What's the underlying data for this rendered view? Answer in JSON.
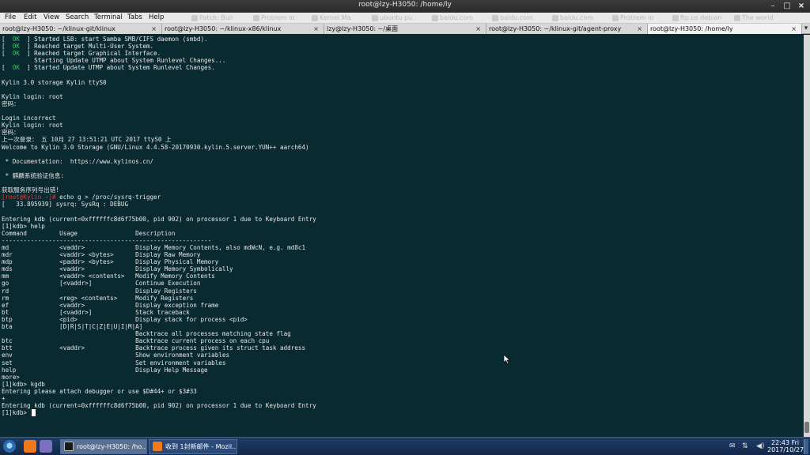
{
  "window": {
    "title": "root@lzy-H3050: /home/ly"
  },
  "menu": {
    "items": [
      "File",
      "Edit",
      "View",
      "Search",
      "Terminal",
      "Tabs",
      "Help"
    ],
    "ghost_tabs": [
      "Patch: Buil",
      "Problem lo",
      "Kernel Ma",
      "ubuntu pu",
      "baidu.com",
      "baidu.com",
      "baidu.com",
      "Problem lo",
      "ftp.us.debian",
      "The world"
    ]
  },
  "tabs": [
    {
      "label": "root@lzy-H3050: ~/klinux-git/klinux",
      "close": "×"
    },
    {
      "label": "root@lzy-H3050: ~/klinux-x86/klinux",
      "close": "×"
    },
    {
      "label": "lzy@lzy-H3050: ~/桌面",
      "close": "×"
    },
    {
      "label": "root@lzy-H3050: ~/klinux-git/agent-proxy",
      "close": "×"
    },
    {
      "label": "root@lzy-H3050: /home/ly",
      "close": "×"
    }
  ],
  "terminal": {
    "lines": [
      "[  OK  ] Started LSB: start Samba SMB/CIFS daemon (smbd).",
      "[  OK  ] Reached target Multi-User System.",
      "[  OK  ] Reached target Graphical Interface.",
      "         Starting Update UTMP about System Runlevel Changes...",
      "[  OK  ] Started Update UTMP about System Runlevel Changes.",
      "",
      "Kylin 3.0 storage Kylin ttyS0",
      "",
      "Kylin login: root",
      "密码：",
      "",
      "Login incorrect",
      "Kylin login: root",
      "密码：",
      "上一次登录： 五 10月 27 13:51:21 UTC 2017 ttyS0 上",
      "Welcome to Kylin 3.0 Storage (GNU/Linux 4.4.58-20170930.kylin.5.server.YUN++ aarch64)",
      "",
      " * Documentation:  https://www.kylinos.cn/",
      "",
      " * 麒麟系统验证信息:",
      "",
      "获取服务序列号出错!",
      "[root@Kylin ~]# echo g > /proc/sysrq-trigger",
      "[   33.895939] sysrq: SysRq : DEBUG",
      "",
      "Entering kdb (current=0xffffffc8d6f75b00, pid 902) on processor 1 due to Keyboard Entry",
      "[1]kdb> help",
      "Command         Usage                Description",
      "----------------------------------------------------------",
      "md              <vaddr>              Display Memory Contents, also mdWcN, e.g. md8c1",
      "mdr             <vaddr> <bytes>      Display Raw Memory",
      "mdp             <paddr> <bytes>      Display Physical Memory",
      "mds             <vaddr>              Display Memory Symbolically",
      "mm              <vaddr> <contents>   Modify Memory Contents",
      "go              [<vaddr>]            Continue Execution",
      "rd                                   Display Registers",
      "rm              <reg> <contents>     Modify Registers",
      "ef              <vaddr>              Display exception frame",
      "bt              [<vaddr>]            Stack traceback",
      "btp             <pid>                Display stack for process <pid>",
      "bta             [D|R|S|T|C|Z|E|U|I|M|A]",
      "                                     Backtrace all processes matching state flag",
      "btc                                  Backtrace current process on each cpu",
      "btt             <vaddr>              Backtrace process given its struct task address",
      "env                                  Show environment variables",
      "set                                  Set environment variables",
      "help                                 Display Help Message",
      "more>",
      "[1]kdb> kgdb",
      "Entering please attach debugger or use $D#44+ or $3#33",
      "+",
      "Entering kdb (current=0xffffffc8d6f75b00, pid 902) on processor 1 due to Keyboard Entry",
      "[1]kdb> "
    ]
  },
  "taskbar": {
    "tasks": [
      {
        "label": "root@lzy-H3050: /ho..."
      },
      {
        "label": "收到 1封新邮件 - Mozil..."
      }
    ],
    "clock": {
      "time": "22:43 Fri",
      "date": "2017/10/27"
    }
  },
  "colors": {
    "terminal_bg": "#0a2a32",
    "terminal_fg": "#e6e6e6",
    "ok_green": "#2fcf4f",
    "prompt_red": "#cf3b3b"
  }
}
